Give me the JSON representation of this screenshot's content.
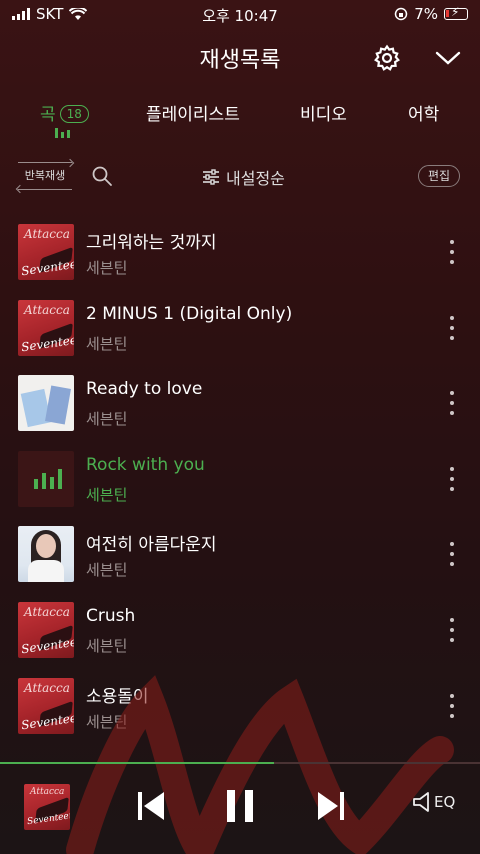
{
  "status_bar": {
    "carrier": "SKT",
    "time": "오후 10:47",
    "battery": "7%"
  },
  "header": {
    "title": "재생목록"
  },
  "tabs": [
    {
      "label": "곡",
      "count": "18"
    },
    {
      "label": "플레이리스트"
    },
    {
      "label": "비디오"
    },
    {
      "label": "어학"
    }
  ],
  "toolbar": {
    "repeat_label": "반복재생",
    "sort_label": "내설정순",
    "edit_label": "편집"
  },
  "songs": [
    {
      "title": "그리워하는 것까지",
      "artist": "세븐틴",
      "cover": "attacca"
    },
    {
      "title": "2 MINUS 1 (Digital Only)",
      "artist": "세븐틴",
      "cover": "attacca"
    },
    {
      "title": "Ready to love",
      "artist": "세븐틴",
      "cover": "ready"
    },
    {
      "title": "Rock with you",
      "artist": "세븐틴",
      "cover": "playing",
      "now_playing": true
    },
    {
      "title": "여전히 아름다운지",
      "artist": "세븐틴",
      "cover": "ost"
    },
    {
      "title": "Crush",
      "artist": "세븐틴",
      "cover": "attacca"
    },
    {
      "title": "소용돌이",
      "artist": "세븐틴",
      "cover": "attacca"
    }
  ],
  "cover_art": {
    "attacca_title": "Attacca",
    "attacca_script": "Seventeen"
  },
  "player": {
    "progress": 0.57,
    "eq_label": "EQ"
  },
  "colors": {
    "accent": "#4caf50",
    "background": "#2e1011"
  }
}
